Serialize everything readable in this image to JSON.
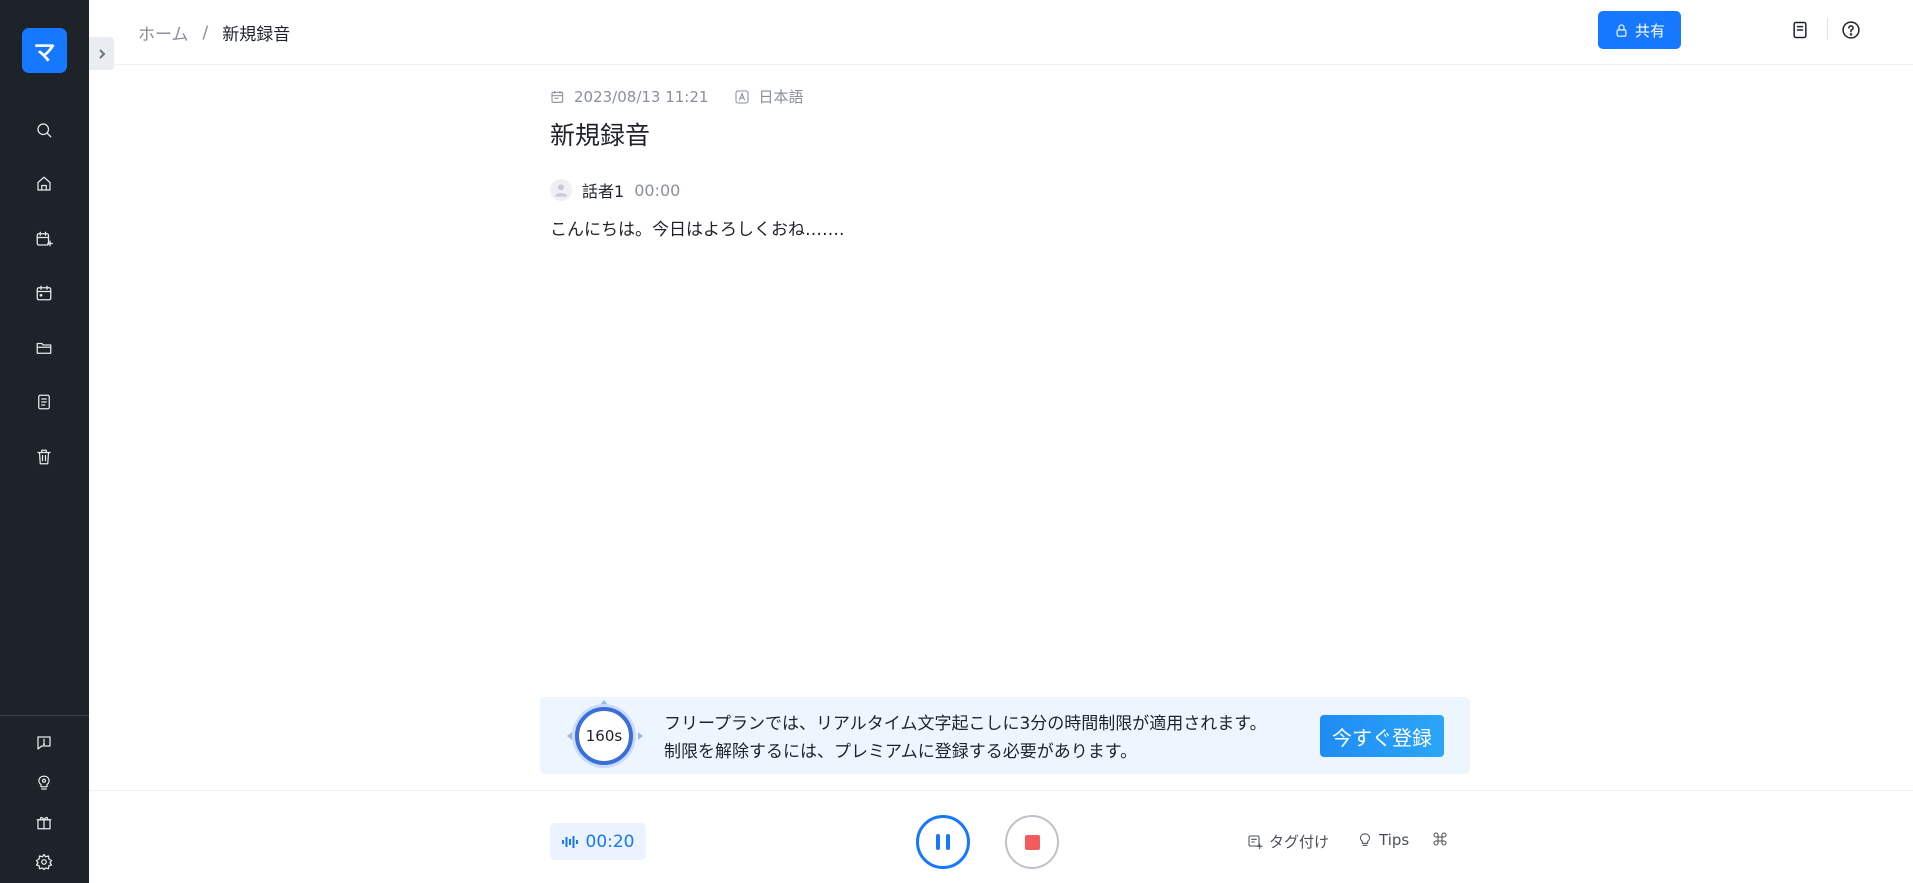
{
  "sidebar": {
    "logo_text": "マ",
    "items": [
      {
        "icon": "search-icon"
      },
      {
        "icon": "home-icon"
      },
      {
        "icon": "calendar-plus-icon"
      },
      {
        "icon": "calendar-icon"
      },
      {
        "icon": "folder-icon"
      },
      {
        "icon": "document-list-icon"
      },
      {
        "icon": "trash-icon"
      }
    ],
    "bottom_items": [
      {
        "icon": "feedback-icon"
      },
      {
        "icon": "lightbulb-icon"
      },
      {
        "icon": "gift-icon"
      },
      {
        "icon": "gear-icon"
      }
    ]
  },
  "header": {
    "breadcrumb": {
      "home": "ホーム",
      "separator": "/",
      "current": "新規録音"
    },
    "share_label": "共有"
  },
  "document": {
    "date": "2023/08/13 11:21",
    "language": "日本語",
    "title": "新規録音",
    "segments": [
      {
        "speaker": "話者1",
        "time": "00:00",
        "text": "こんにちは。今日はよろしくおね……."
      }
    ]
  },
  "banner": {
    "timer": "160s",
    "line1": "フリープランでは、リアルタイム文字起こしに3分の時間制限が適用されます。",
    "line2": "制限を解除するには、プレミアムに登録する必要があります。",
    "button": "今すぐ登録"
  },
  "controls": {
    "elapsed": "00:20",
    "tag_label": "タグ付け",
    "tips_label": "Tips"
  },
  "colors": {
    "sidebar_bg": "#1e2229",
    "accent": "#1677ff",
    "stop": "#f25c5c",
    "banner_bg": "#edf5ff"
  }
}
